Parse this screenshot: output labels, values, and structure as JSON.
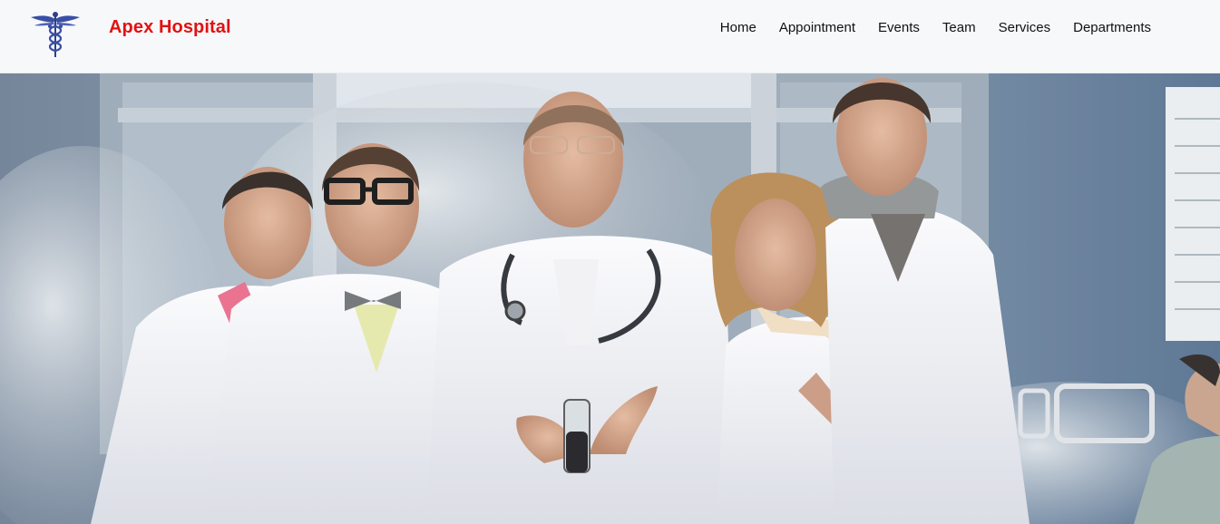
{
  "brand": {
    "name": "Apex Hospital",
    "logo_icon": "caduceus-icon",
    "color": "#e11212"
  },
  "nav": {
    "items": [
      {
        "label": "Home"
      },
      {
        "label": "Appointment"
      },
      {
        "label": "Events"
      },
      {
        "label": "Team"
      },
      {
        "label": "Services"
      },
      {
        "label": "Departments"
      }
    ]
  },
  "hero": {
    "image": "hero-doctors-image"
  },
  "colors": {
    "navbar_bg": "#f7f8fa",
    "logo_blue": "#3a4fa3"
  }
}
